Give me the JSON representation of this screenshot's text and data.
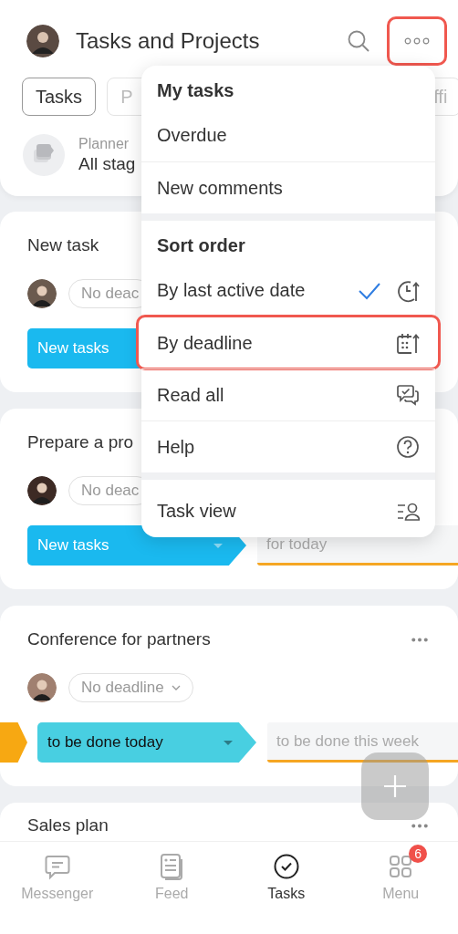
{
  "header": {
    "title": "Tasks and Projects",
    "more_highlighted": true
  },
  "tabs": [
    {
      "label": "Tasks",
      "selected": true
    },
    {
      "label": "P",
      "selected": false
    },
    {
      "label": "ffi",
      "selected": false
    }
  ],
  "planner": {
    "label": "Planner",
    "value": "All stag"
  },
  "cards": [
    {
      "title": "New task",
      "deadline": "No deac",
      "deadline_dropdown": false,
      "stages": [
        {
          "label": "New tasks",
          "kind": "current",
          "color": "#1ab9ef"
        }
      ]
    },
    {
      "title": "Prepare a pro",
      "deadline": "No deac",
      "deadline_dropdown": false,
      "stages": [
        {
          "label": "New tasks",
          "kind": "current",
          "color": "#1ab9ef"
        },
        {
          "label": "for today",
          "kind": "next",
          "color": "#f5a623"
        }
      ]
    },
    {
      "title": "Conference for partners",
      "menu_button": true,
      "deadline": "No deadline",
      "deadline_dropdown": true,
      "stages": [
        {
          "kind": "previous",
          "color": "#f7a812"
        },
        {
          "label": "to be done today",
          "kind": "current",
          "color": "#48cfe1"
        },
        {
          "label": "to be done this week",
          "kind": "next",
          "color": "#f5a623"
        }
      ]
    },
    {
      "title": "Sales plan",
      "menu_button": true
    }
  ],
  "menu": {
    "sections": [
      {
        "items": [
          {
            "kind": "header",
            "label": "My tasks"
          },
          {
            "kind": "item",
            "label": "Overdue",
            "highlighted": false
          },
          {
            "kind": "item",
            "label": "New comments",
            "highlighted": false
          }
        ]
      },
      {
        "items": [
          {
            "kind": "header",
            "label": "Sort order"
          },
          {
            "kind": "sort",
            "label": "By last active date",
            "selected": true,
            "highlighted": false
          },
          {
            "kind": "sort",
            "label": "By deadline",
            "selected": false,
            "highlighted": true
          },
          {
            "kind": "item",
            "label": "Read all",
            "highlighted": false
          },
          {
            "kind": "item",
            "label": "Help",
            "highlighted": false
          }
        ]
      },
      {
        "items": [
          {
            "kind": "item",
            "label": "Task view",
            "highlighted": false
          }
        ]
      }
    ]
  },
  "nav": [
    {
      "label": "Messenger",
      "selected": false
    },
    {
      "label": "Feed",
      "selected": false
    },
    {
      "label": "Tasks",
      "selected": true
    },
    {
      "label": "Menu",
      "selected": false,
      "badge": "6"
    }
  ]
}
